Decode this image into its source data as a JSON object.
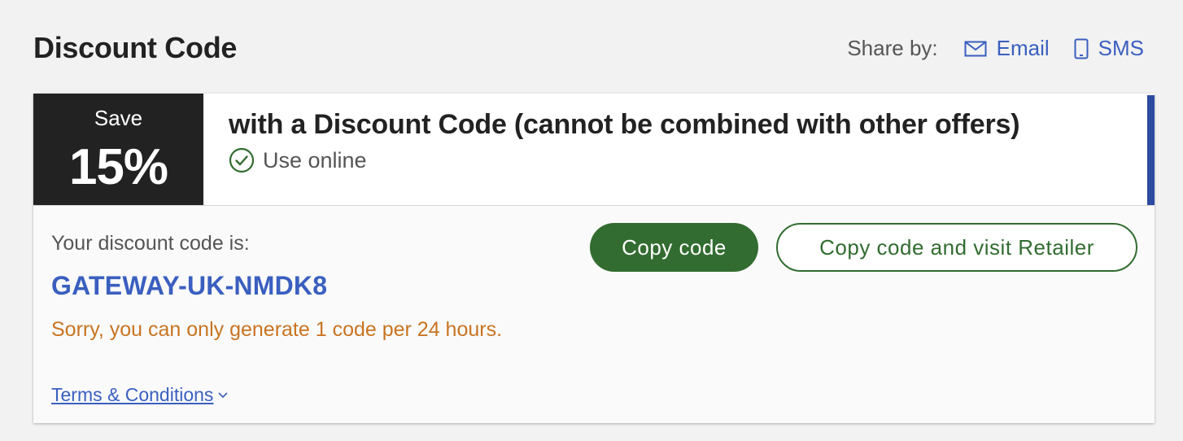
{
  "header": {
    "title": "Discount Code",
    "share_label": "Share by:",
    "share_email": "Email",
    "share_sms": "SMS"
  },
  "offer": {
    "save_label": "Save",
    "percent": "15%",
    "title": "with a Discount Code (cannot be combined with other offers)",
    "use_online": "Use online"
  },
  "code_section": {
    "label": "Your discount code is:",
    "code": "GATEWAY-UK-NMDK8",
    "warning": "Sorry, you can only generate 1 code per 24 hours.",
    "copy_button": "Copy code",
    "copy_visit_button": "Copy code and visit Retailer",
    "terms_link": "Terms & Conditions"
  },
  "colors": {
    "accent_blue": "#3a5fbf",
    "accent_bar": "#2b4aa0",
    "primary_green": "#326c30",
    "warning_orange": "#c87422",
    "badge_dark": "#222222"
  },
  "icons": {
    "email": "envelope-icon",
    "sms": "mobile-phone-icon",
    "use_online": "check-circle-icon",
    "terms": "chevron-down-icon"
  }
}
